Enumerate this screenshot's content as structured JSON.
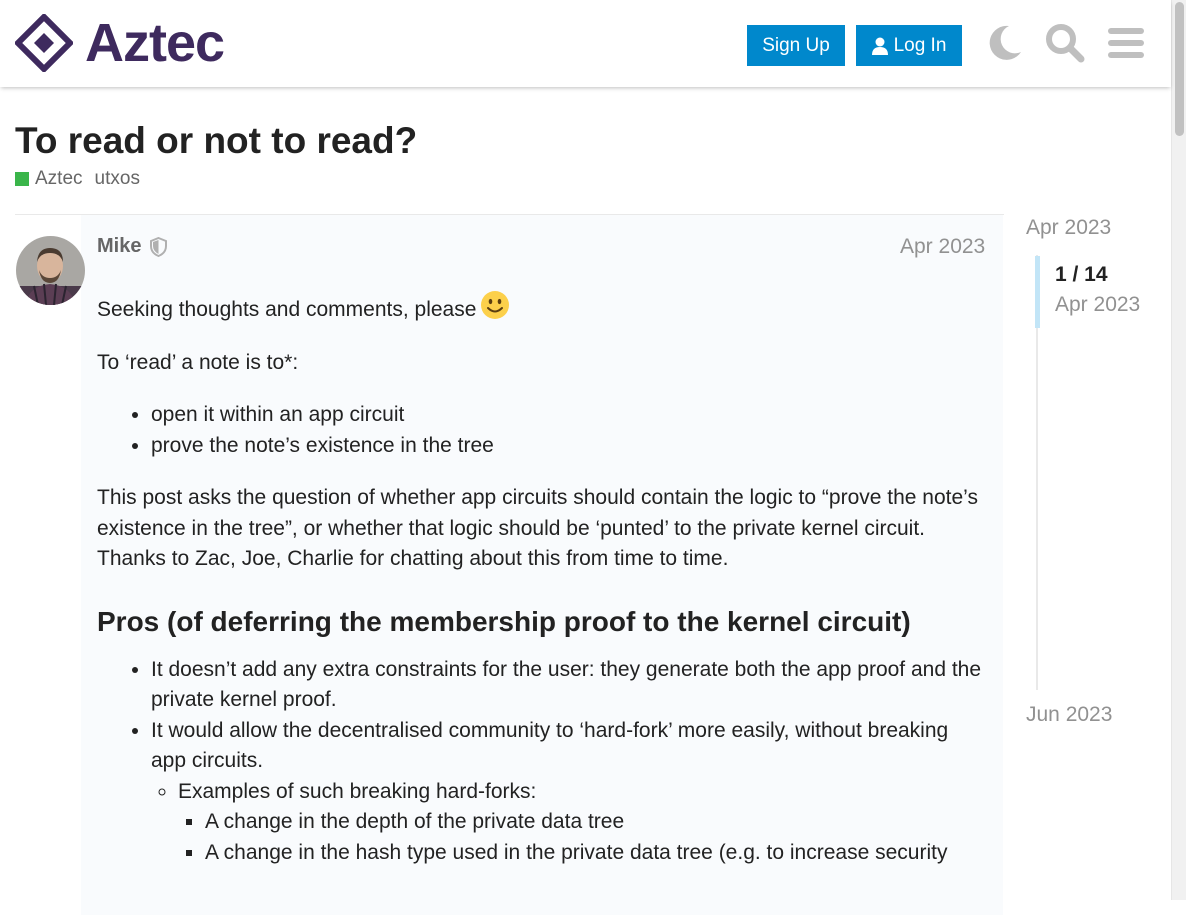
{
  "header": {
    "logo_text": "Aztec",
    "signup_label": "Sign Up",
    "login_label": "Log In"
  },
  "topic": {
    "title": "To read or not to read?",
    "category": "Aztec",
    "category_color": "#3ab54a",
    "tags": [
      "utxos"
    ]
  },
  "post": {
    "username": "Mike",
    "date": "Apr 2023",
    "intro": "Seeking thoughts and comments, please",
    "read_def": "To ‘read’ a note is to*:",
    "read_items": [
      "open it within an app circuit",
      "prove the note’s existence in the tree"
    ],
    "question": "This post asks the question of whether app circuits should contain the logic to “prove the note’s existence in the tree”, or whether that logic should be ‘punted’ to the private kernel circuit.",
    "thanks": "Thanks to Zac, Joe, Charlie for chatting about this from time to time.",
    "pros_heading": "Pros (of deferring the membership proof to the kernel circuit)",
    "pros": [
      "It doesn’t add any extra constraints for the user: they generate both the app proof and the private kernel proof.",
      "It would allow the decentralised community to ‘hard-fork’ more easily, without breaking app circuits."
    ],
    "examples_label": "Examples of such breaking hard-forks:",
    "examples": [
      "A change in the depth of the private data tree",
      "A change in the hash type used in the private data tree (e.g. to increase security"
    ]
  },
  "timeline": {
    "start": "Apr 2023",
    "position": "1 / 14",
    "current_date": "Apr 2023",
    "end": "Jun 2023"
  },
  "colors": {
    "brand": "#3e2a5e",
    "button": "#0088cc",
    "muted": "#919191"
  },
  "icons": [
    "moon-icon",
    "search-icon",
    "hamburger-menu-icon",
    "user-icon",
    "shield-icon",
    "smiley-icon"
  ]
}
